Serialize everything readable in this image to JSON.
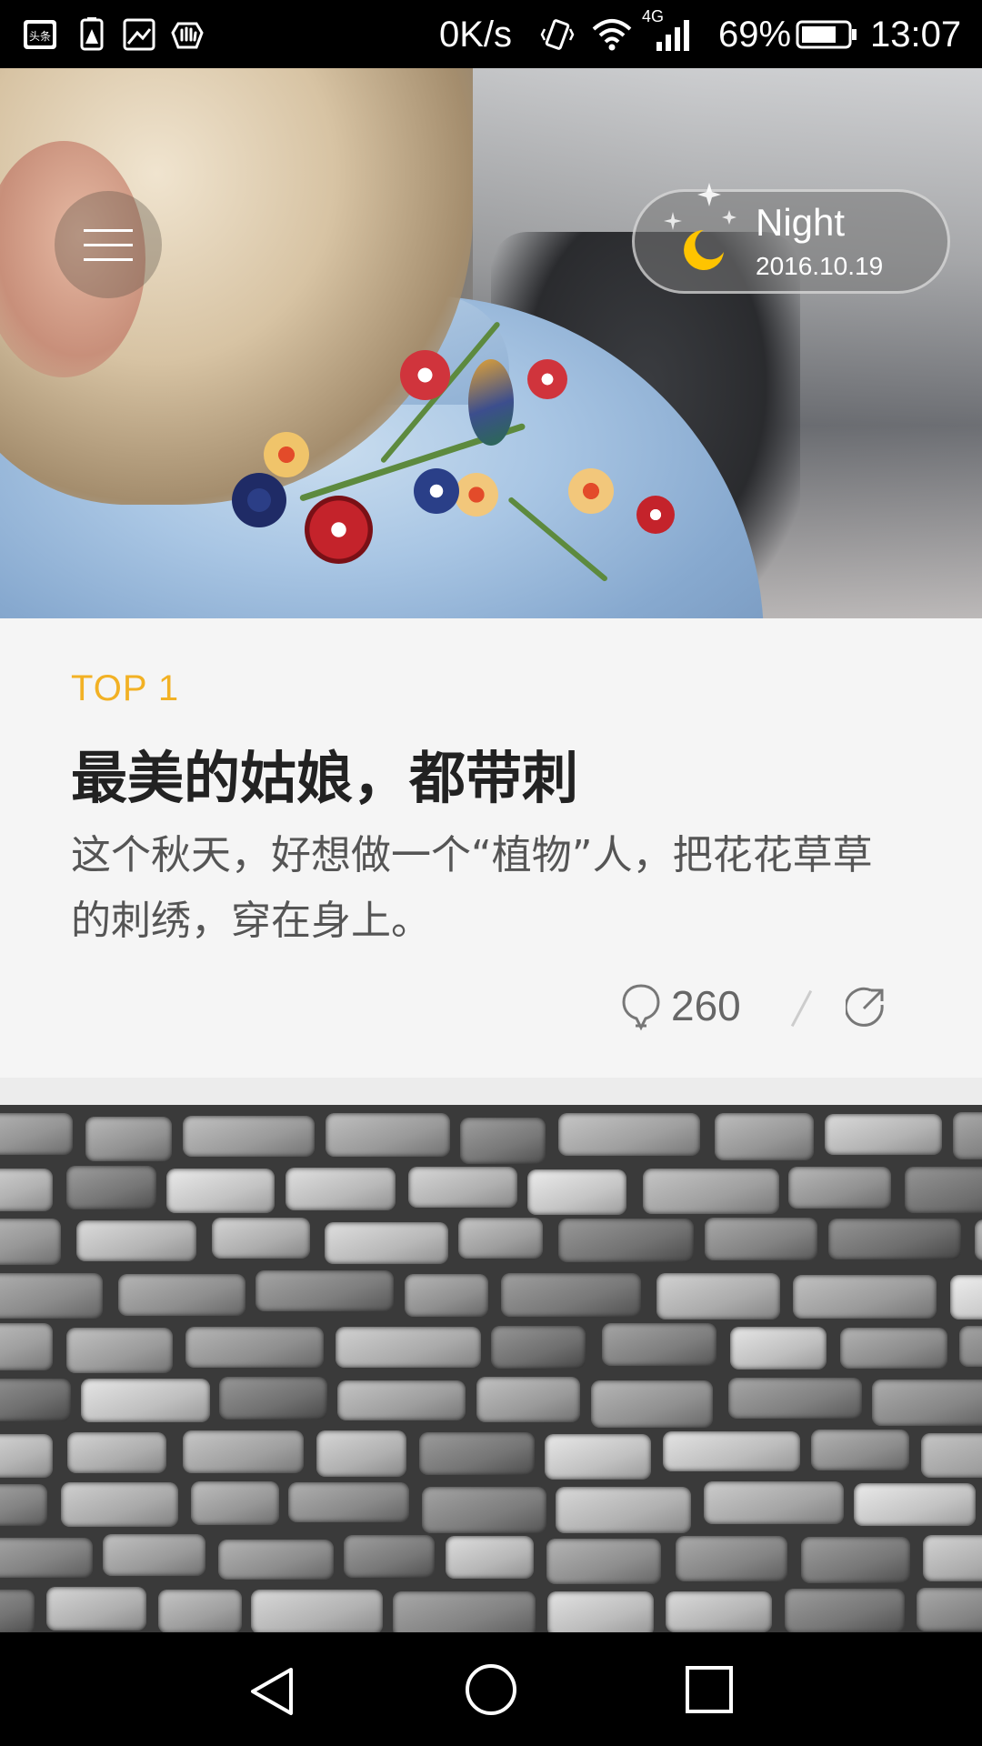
{
  "status_bar": {
    "network_speed": "0K/s",
    "network_type": "4G",
    "battery": "69%",
    "time": "13:07",
    "icons": [
      "toutiao-app-icon",
      "battery-alert-icon",
      "image-icon",
      "hand-icon",
      "vibrate-icon",
      "wifi-icon",
      "signal-icon",
      "battery-icon"
    ]
  },
  "header": {
    "weather_mode": "Night",
    "date": "2016.10.19"
  },
  "article": {
    "rank": "TOP 1",
    "title": "最美的姑娘，都带刺",
    "summary": "这个秋天，好想做一个“植物”人，把花花草草的刺绣，穿在身上。",
    "comment_count": "260"
  },
  "colors": {
    "accent": "#f2b124",
    "moon": "#ffc400",
    "background": "#f5f5f5"
  },
  "nav_bar": {
    "buttons": [
      "back-icon",
      "home-icon",
      "recents-icon"
    ]
  }
}
